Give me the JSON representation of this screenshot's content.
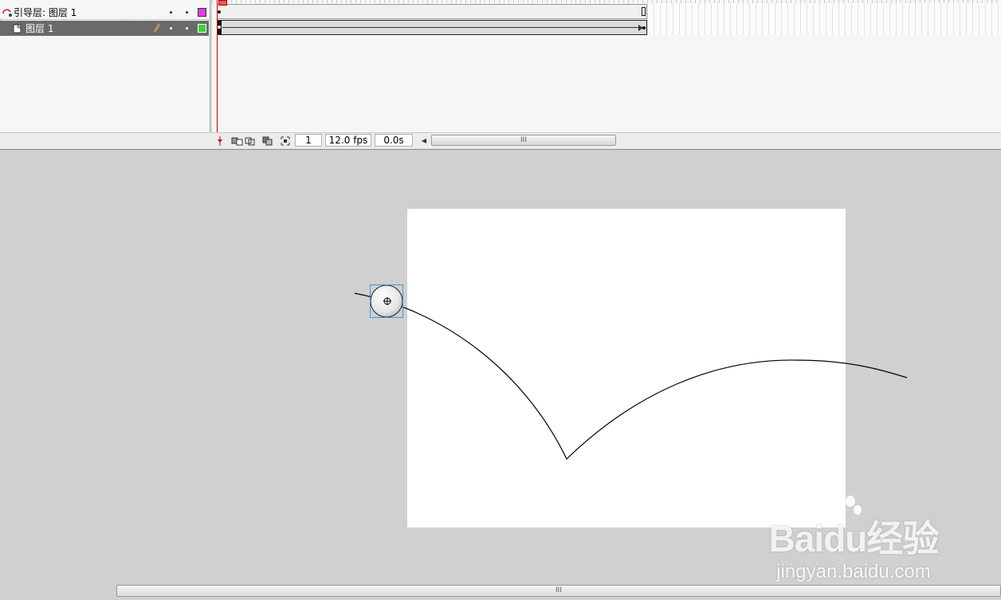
{
  "layers": [
    {
      "name": "引导层: 图层 1",
      "type": "guide",
      "color": "#e040e0"
    },
    {
      "name": "图层 1",
      "type": "normal",
      "color": "#40d040",
      "selected": true
    }
  ],
  "timeline": {
    "current_frame": "1",
    "fps": "12.0 fps",
    "elapsed": "0.0s",
    "scroll_grip": "III"
  },
  "watermark": {
    "brand": "Baidu经验",
    "url": "jingyan.baidu.com"
  },
  "scrollbars": {
    "bottom_grip": "III"
  },
  "icons": {
    "add_guide": "add-motion-guide-icon",
    "insert_folder": "insert-folder-icon",
    "delete": "trash-icon",
    "pencil": "pencil-icon"
  }
}
